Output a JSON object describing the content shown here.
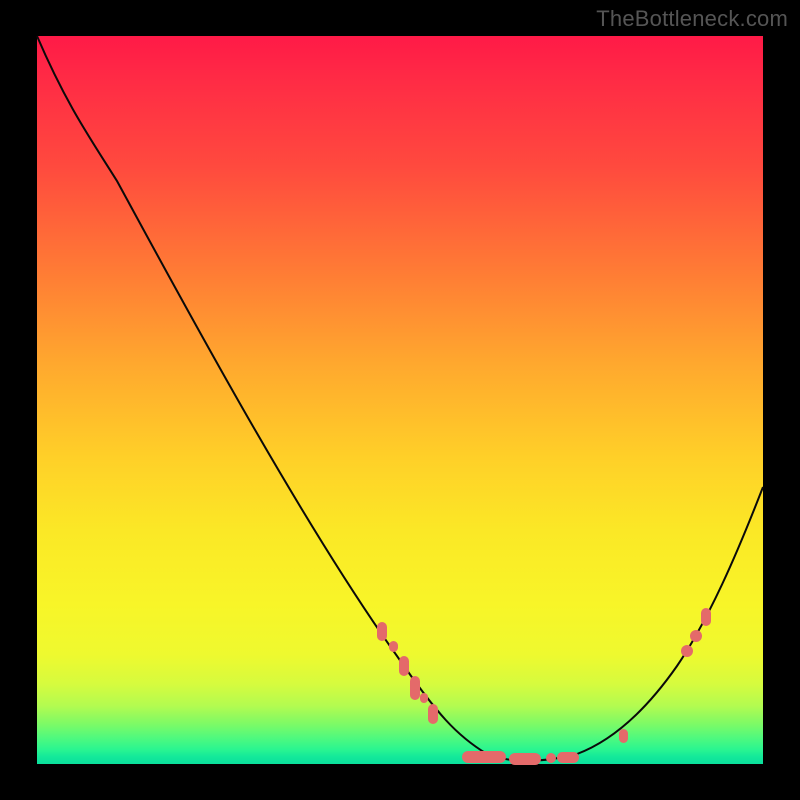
{
  "watermark": "TheBottleneck.com",
  "chart_data": {
    "type": "line",
    "title": "",
    "xlabel": "",
    "ylabel": "",
    "xlim": [
      0,
      100
    ],
    "ylim": [
      0,
      100
    ],
    "grid": false,
    "background": "red-yellow-green vertical gradient (red top, green bottom)",
    "series": [
      {
        "name": "bottleneck-curve",
        "x": [
          0,
          5,
          10,
          15,
          20,
          25,
          30,
          35,
          40,
          45,
          50,
          55,
          60,
          62,
          65,
          68,
          72,
          76,
          80,
          84,
          88,
          92,
          96,
          100
        ],
        "y": [
          100,
          92,
          85,
          78,
          70,
          62,
          54,
          46,
          38,
          30,
          22,
          15,
          8,
          5,
          3,
          1,
          0,
          0,
          1,
          4,
          9,
          18,
          28,
          38
        ]
      }
    ],
    "markers": {
      "note": "salmon markers highlight points on curve near the bottom; values are (x, y) estimates",
      "points": [
        [
          47,
          18
        ],
        [
          48.5,
          16
        ],
        [
          50,
          13
        ],
        [
          51.5,
          11
        ],
        [
          53,
          8.5
        ],
        [
          54,
          6.5
        ],
        [
          61,
          0.8
        ],
        [
          66,
          0.5
        ],
        [
          70,
          0.5
        ],
        [
          71,
          0.6
        ],
        [
          73,
          0.8
        ],
        [
          81,
          4
        ],
        [
          89.5,
          15.5
        ],
        [
          91,
          17.5
        ],
        [
          92,
          20
        ]
      ],
      "color": "#e46a6a"
    }
  }
}
